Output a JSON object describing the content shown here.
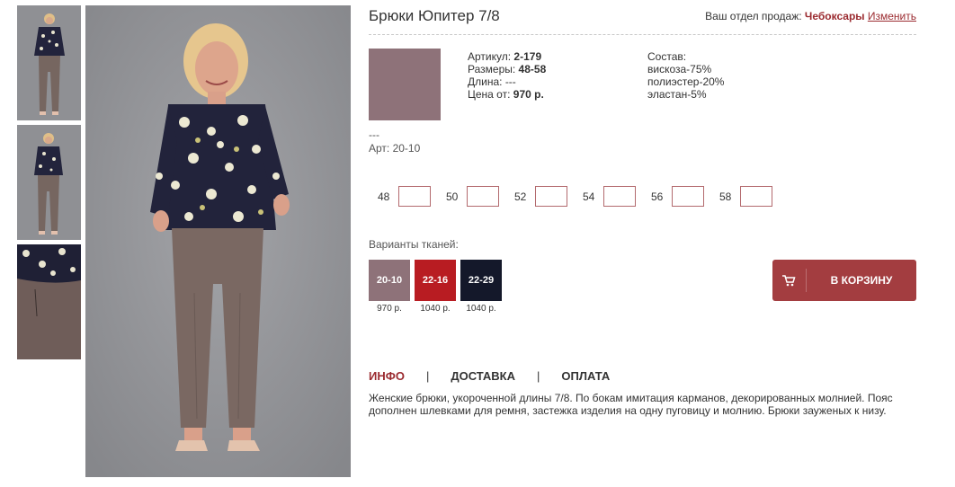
{
  "product": {
    "title": "Брюки Юпитер 7/8",
    "color_hex": "#8e7279"
  },
  "department": {
    "label": "Ваш отдел продаж:",
    "city": "Чебоксары",
    "change_link": "Изменить"
  },
  "specs": {
    "article_label": "Артикул:",
    "article_value": "2-179",
    "sizes_label": "Размеры:",
    "sizes_value": "48-58",
    "length_label": "Длина:",
    "length_value": "---",
    "price_label": "Цена от:",
    "price_value": "970 р."
  },
  "composition": {
    "label": "Состав:",
    "items": [
      "вискоза-75%",
      "полиэстер-20%",
      "эластан-5%"
    ]
  },
  "variant_info": {
    "dashes": "---",
    "art": "Арт: 20-10"
  },
  "sizes": [
    "48",
    "50",
    "52",
    "54",
    "56",
    "58"
  ],
  "fabrics": {
    "label": "Варианты тканей:",
    "items": [
      {
        "code": "20-10",
        "price": "970 р.",
        "color": "#8e7279"
      },
      {
        "code": "22-16",
        "price": "1040 р.",
        "color": "#b81c22"
      },
      {
        "code": "22-29",
        "price": "1040 р.",
        "color": "#14182a"
      }
    ]
  },
  "cart": {
    "label": "В КОРЗИНУ",
    "icon": "cart-icon"
  },
  "tabs": [
    {
      "label": "ИНФО",
      "active": true
    },
    {
      "label": "ДОСТАВКА",
      "active": false
    },
    {
      "label": "ОПЛАТА",
      "active": false
    }
  ],
  "description": "Женские брюки, укороченной длины 7/8. По бокам имитация карманов, декорированных молнией. Пояс дополнен шлевками для ремня, застежка изделия на одну пуговицу и молнию. Брюки зауженых к низу.",
  "colors": {
    "accent": "#9b2b30",
    "button": "#a33d40"
  }
}
